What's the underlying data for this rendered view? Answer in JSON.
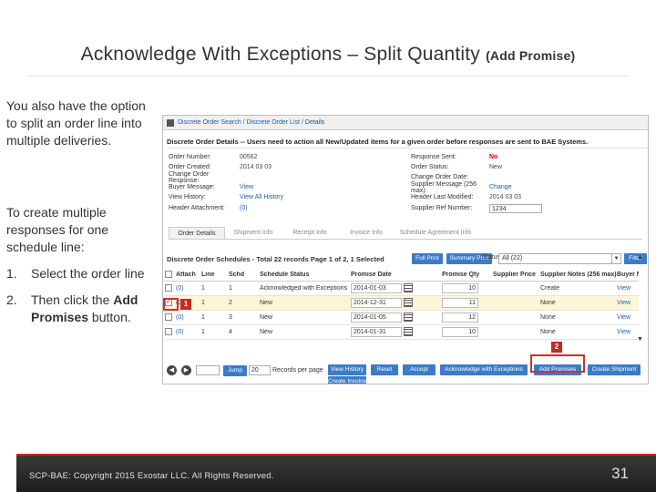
{
  "slide": {
    "title": "Acknowledge With Exceptions – Split Quantity",
    "title_suffix": "(Add Promise)",
    "intro": "You also have the option to split an order line into multiple deliveries.",
    "create_text": "To create multiple responses for one schedule line:",
    "steps": [
      {
        "num": "1.",
        "text": "Select the order line"
      },
      {
        "num": "2.",
        "text_pre": "Then click the ",
        "text_bold": "Add Promises",
        "text_post": " button."
      }
    ],
    "footer_copyright": "SCP-BAE: Copyright 2015 Exostar LLC. All Rights Reserved.",
    "page_number": "31"
  },
  "screenshot": {
    "breadcrumb": [
      "Discrete Order Search",
      "Discrete Order List",
      "Details"
    ],
    "details_header": "Discrete Order Details -- Users need to action all New/Updated items for a given order before responses are sent to BAE Systems.",
    "left_fields": [
      {
        "label": "Order Number:",
        "value": "00562"
      },
      {
        "label": "Order Created:",
        "value": "2014 03 03"
      },
      {
        "label": "Change Order Response:",
        "value": ""
      },
      {
        "label": "Buyer Message:",
        "value": "View"
      },
      {
        "label": "View History:",
        "value": "View All History"
      },
      {
        "label": "Header Attachment:",
        "value": "(0)"
      }
    ],
    "right_fields": [
      {
        "label": "Response Sent:",
        "value": "No"
      },
      {
        "label": "Order Status:",
        "value": "New"
      },
      {
        "label": "Change Order Date:",
        "value": ""
      },
      {
        "label": "Supplier Message (256 max):",
        "value": "Change"
      },
      {
        "label": "Header Last Modified:",
        "value": "2014 03 03"
      },
      {
        "label": "Supplier Ref Number:",
        "value": "1234"
      }
    ],
    "tabs": [
      "Order Details",
      "Shipment Info",
      "Receipt Info",
      "Invoice Info",
      "Schedule Agreement Info"
    ],
    "schedules_title": "Discrete Order Schedules - Total 22 records Page 1 of 2, 1 Selected",
    "buttons_top": [
      "Full Print",
      "Summary Print"
    ],
    "status_label": "Status:",
    "status_value": "All (22)",
    "filter_button": "Filter",
    "columns": [
      "Attach",
      "Line",
      "Schd",
      "Schedule Status",
      "Promise Date",
      "Promise Qty",
      "Supplier Price",
      "Supplier Notes (256 max)",
      "Buyer N"
    ],
    "rows": [
      {
        "attach": "(0)",
        "line": "1",
        "schd": "1",
        "status": "Acknowledged with Exceptions",
        "date": "2014-01-03",
        "qty": "10",
        "notes": "Create",
        "view": "View",
        "checked": false
      },
      {
        "attach": "(0)",
        "line": "1",
        "schd": "2",
        "status": "New",
        "date": "2014-12-31",
        "qty": "11",
        "notes": "None",
        "view": "View",
        "checked": true
      },
      {
        "attach": "(0)",
        "line": "1",
        "schd": "3",
        "status": "New",
        "date": "2014-01-05",
        "qty": "12",
        "notes": "None",
        "view": "View",
        "checked": false
      },
      {
        "attach": "(0)",
        "line": "1",
        "schd": "4",
        "status": "New",
        "date": "2014-01-31",
        "qty": "10",
        "notes": "None",
        "view": "View",
        "checked": false
      }
    ],
    "records_per_page_label": "Records per page",
    "jump_button": "Jump",
    "per_page_value": "20",
    "action_buttons": [
      "View History",
      "Reset",
      "Accept",
      "Acknowledge with Exceptions",
      "Add Promises",
      "Create Shipment"
    ],
    "create_invoice_button": "Create Invoice",
    "callout_1": "1",
    "callout_2": "2"
  },
  "colors": {
    "accent_blue": "#3d7bc6",
    "callout_red": "#c62828",
    "selected_row": "#fdf5d8"
  }
}
